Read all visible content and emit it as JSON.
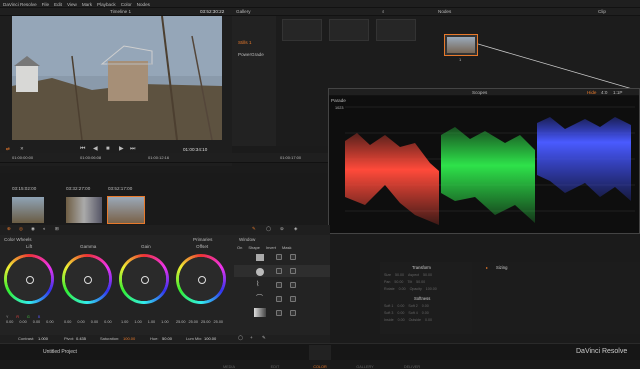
{
  "app_name": "DaVinci Resolve",
  "menu": [
    "File",
    "Edit",
    "View",
    "Mark",
    "Playback",
    "Color",
    "Nodes"
  ],
  "main_timecode": "03:52:30:22",
  "viewer": {
    "timeline_label": "Timeline 1",
    "timecode": "01:00:34:10"
  },
  "gallery": {
    "label": "Gallery",
    "items": [
      "Stills 1",
      "PowerGrade"
    ]
  },
  "nodes": {
    "label": "Nodes",
    "clip_label": "Clip",
    "node_number": "1"
  },
  "timeline_ruler": [
    "01:00:00:00",
    "01:00:06:08",
    "01:00:12:16",
    "01:00:17:00"
  ],
  "clips": [
    {
      "tc": "03:15:02:00",
      "label": "01  v1"
    },
    {
      "tc": "03:32:27:00",
      "label": "02  v1"
    },
    {
      "tc": "03:52:17:00",
      "label": "03  v1"
    }
  ],
  "scopes": {
    "title": "Scopes",
    "mode": "Parade",
    "tick_1023": "1023",
    "header_right": [
      "Hide",
      "4:0",
      "1:1P"
    ]
  },
  "color_wheels": {
    "title": "Color Wheels",
    "mode": "Primaries",
    "wheels": [
      {
        "name": "Lift",
        "values": [
          "0.00",
          "0.00",
          "0.00",
          "0.00"
        ]
      },
      {
        "name": "Gamma",
        "values": [
          "0.00",
          "0.00",
          "0.00",
          "0.00"
        ]
      },
      {
        "name": "Gain",
        "values": [
          "1.00",
          "1.00",
          "1.00",
          "1.00"
        ]
      },
      {
        "name": "Offset",
        "values": [
          "25.00",
          "25.00",
          "25.00",
          "25.00"
        ]
      }
    ],
    "channel_labels": [
      "Y",
      "R",
      "G",
      "B"
    ]
  },
  "footer_params": {
    "contrast": {
      "label": "Contrast:",
      "value": "1.000"
    },
    "pivot": {
      "label": "Pivot:",
      "value": "0.435"
    },
    "saturation": {
      "label": "Saturation:",
      "value": "100.00"
    },
    "hue": {
      "label": "Hue:",
      "value": "50.00"
    },
    "lum_mix": {
      "label": "Lum Mix:",
      "value": "100.00"
    }
  },
  "window_panel": {
    "title": "Window",
    "columns": [
      "On",
      "Shape",
      "Invert",
      "Mask"
    ],
    "transform": "Transform",
    "softness": "Softness",
    "sizing": "Sizing",
    "transform_rows": [
      [
        "Size",
        "50.00",
        "Aspect",
        "50.00"
      ],
      [
        "Pan",
        "50.00",
        "Tilt",
        "50.00"
      ],
      [
        "Rotate",
        "0.00",
        "Opacity",
        "100.00"
      ]
    ],
    "softness_rows": [
      [
        "Soft 1",
        "0.00",
        "Soft 2",
        "0.00"
      ],
      [
        "Soft 3",
        "0.00",
        "Soft 4",
        "0.00"
      ],
      [
        "Inside",
        "0.00",
        "Outside",
        "0.00"
      ]
    ]
  },
  "project_name": "Untitled Project",
  "pages": [
    "MEDIA",
    "EDIT",
    "COLOR",
    "GALLERY",
    "DELIVER"
  ],
  "brand": "DaVinci Resolve",
  "colors": {
    "accent": "#e8792b",
    "red": "#ff4a3a",
    "green": "#2ee24a",
    "blue": "#3a4bff"
  }
}
